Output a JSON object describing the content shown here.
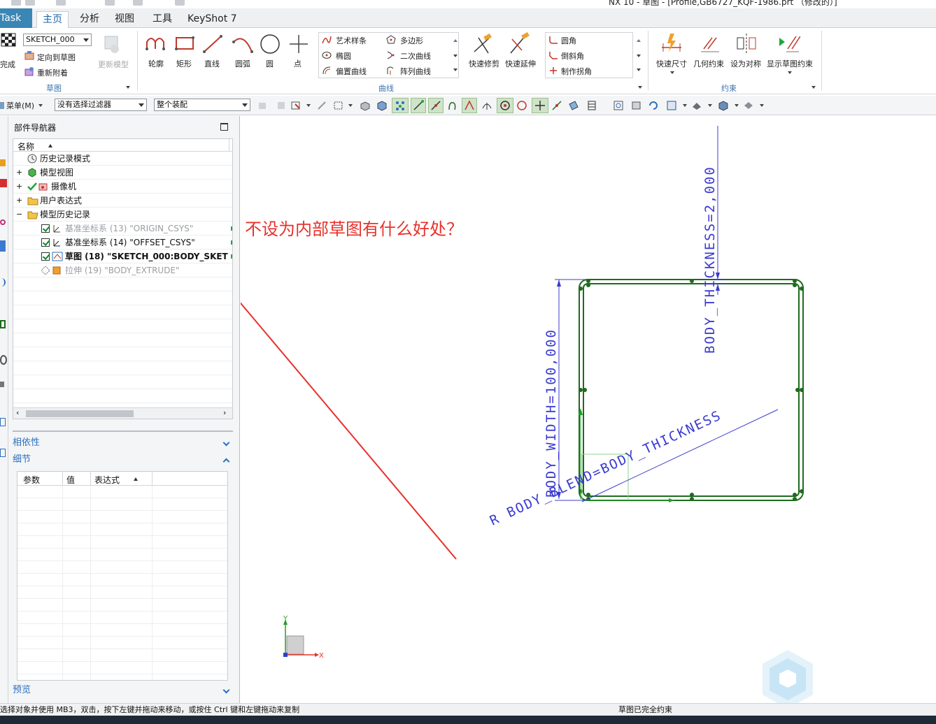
{
  "window": {
    "title": "NX 10 - 草图 - [Profile,GB6727_KQF-1986.prt （修改的）]"
  },
  "tabs": [
    {
      "label": "Task"
    },
    {
      "label": "主页"
    },
    {
      "label": "分析"
    },
    {
      "label": "视图"
    },
    {
      "label": "工具"
    },
    {
      "label": "KeyShot 7"
    }
  ],
  "ribbon": {
    "finish_label": "完成",
    "sketch_combo_value": "SKETCH_000",
    "orient_to_sketch": "定向到草图",
    "reattach": "重新附着",
    "update_model": "更新模型",
    "sketch_group_title": "草图",
    "curve_tools": [
      "轮廓",
      "矩形",
      "直线",
      "圆弧",
      "圆",
      "点"
    ],
    "curve_list_col1": [
      "艺术样条",
      "椭圆",
      "偏置曲线"
    ],
    "curve_list_col2": [
      "多边形",
      "二次曲线",
      "阵列曲线"
    ],
    "quick_trim": "快速修剪",
    "quick_extend": "快速延伸",
    "corner_list": [
      "圆角",
      "倒斜角",
      "制作拐角"
    ],
    "curve_group_title": "曲线",
    "constraint_tools": [
      "快速尺寸",
      "几何约束",
      "设为对称",
      "显示草图约束"
    ],
    "constraint_group_title": "约束"
  },
  "toolbar2": {
    "menu_label": "菜单(M)",
    "filter_value": "没有选择过滤器",
    "assembly_value": "整个装配"
  },
  "navigator": {
    "title": "部件导航器",
    "column_name": "名称",
    "rows": [
      {
        "label": "历史记录模式",
        "state": "normal"
      },
      {
        "label": "模型视图",
        "state": "normal"
      },
      {
        "label": "摄像机",
        "state": "normal"
      },
      {
        "label": "用户表达式",
        "state": "normal"
      },
      {
        "label": "模型历史记录",
        "state": "normal"
      },
      {
        "label": "基准坐标系 (13) \"ORIGIN_CSYS\"",
        "state": "grey"
      },
      {
        "label": "基准坐标系 (14) \"OFFSET_CSYS\"",
        "state": "normal"
      },
      {
        "label": "草图 (18) \"SKETCH_000:BODY_SKET",
        "state": "bold"
      },
      {
        "label": "拉伸 (19) \"BODY_EXTRUDE\"",
        "state": "grey"
      }
    ],
    "dependency_label": "相依性",
    "details_label": "细节",
    "details_columns": [
      "参数",
      "值",
      "表达式"
    ],
    "preview_label": "预览"
  },
  "viewport": {
    "annotation": "不设为内部草图有什么好处？",
    "dim_thickness": "BODY_THICKNESS=2,000",
    "dim_width": "BODY_WIDTH=100,000",
    "dim_blend": "R BODY_BLEND=BODY_THICKNESS",
    "axis_x": "X",
    "axis_y": "Y"
  },
  "status": {
    "left": "选择对象并使用 MB3，双击，按下左键并拖动来移动，或按住 Ctrl 键和左键拖动来复制",
    "right": "草图已完全约束"
  },
  "colors": {
    "tab_task": "#3a86b5",
    "accent": "#2a70c0",
    "sketch_green": "#1e6b1e",
    "dimension_blue": "#3b3bd0",
    "annotation_red": "#e8312a"
  }
}
